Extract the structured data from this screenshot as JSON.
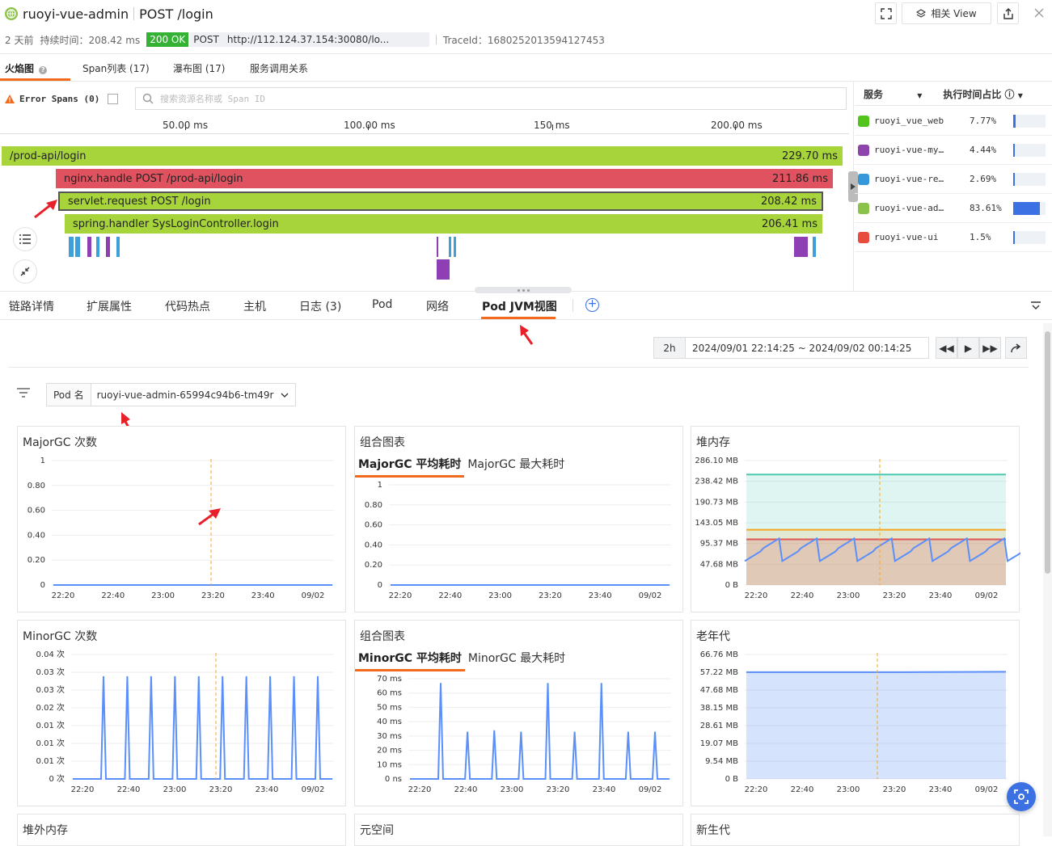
{
  "header": {
    "app": "ruoyi-vue-admin",
    "operation": "POST /login",
    "related_view": "相关 View",
    "time_ago": "2 天前",
    "duration_label": "持续时间：208.42 ms",
    "status": "200 OK",
    "method": "POST",
    "url": "http://112.124.37.154:30080/lo...",
    "trace_id": "TraceId：1680252013594127453"
  },
  "tabs": [
    {
      "label": "火焰图"
    },
    {
      "label": "Span列表 (17)"
    },
    {
      "label": "瀑布图 (17)"
    },
    {
      "label": "服务调用关系"
    }
  ],
  "flame": {
    "error_spans": "Error Spans (0)",
    "search_placeholder": "搜索资源名称或 Span ID",
    "axis": [
      "50.00 ms",
      "100.00 ms",
      "150 ms",
      "200.00 ms"
    ],
    "spans": [
      {
        "name": "/prod-api/login",
        "duration": "229.70 ms"
      },
      {
        "name": "nginx.handle POST /prod-api/login",
        "duration": "211.86 ms"
      },
      {
        "name": "servlet.request POST /login",
        "duration": "208.42 ms"
      },
      {
        "name": "spring.handler SysLoginController.login",
        "duration": "206.41 ms"
      }
    ]
  },
  "services": {
    "col_service": "服务",
    "col_ratio": "执行时间占比",
    "rows": [
      {
        "name": "ruoyi_vue_web",
        "pct": "7.77%",
        "ratio": 0.0777,
        "color": "#52c41a"
      },
      {
        "name": "ruoyi-vue-my…",
        "pct": "4.44%",
        "ratio": 0.0444,
        "color": "#8e44ad"
      },
      {
        "name": "ruoyi-vue-re…",
        "pct": "2.69%",
        "ratio": 0.0269,
        "color": "#3498db"
      },
      {
        "name": "ruoyi-vue-ad…",
        "pct": "83.61%",
        "ratio": 0.8361,
        "color": "#8bc34a"
      },
      {
        "name": "ruoyi-vue-ui",
        "pct": "1.5%",
        "ratio": 0.015,
        "color": "#e74c3c"
      }
    ]
  },
  "detail_tabs": [
    {
      "label": "链路详情"
    },
    {
      "label": "扩展属性"
    },
    {
      "label": "代码热点"
    },
    {
      "label": "主机"
    },
    {
      "label": "日志 (3)"
    },
    {
      "label": "Pod"
    },
    {
      "label": "网络"
    },
    {
      "label": "Pod JVM视图"
    }
  ],
  "timerange": {
    "preset": "2h",
    "range": "2024/09/01 22:14:25 ~ 2024/09/02 00:14:25"
  },
  "pod_filter": {
    "label": "Pod 名",
    "value": "ruoyi-vue-admin-65994c94b6-tm49r"
  },
  "chart_data": [
    {
      "type": "line",
      "title": "MajorGC 次数",
      "x": [
        "22:20",
        "22:40",
        "23:00",
        "23:20",
        "23:40",
        "09/02"
      ],
      "y_ticks": [
        "1",
        "0.80",
        "0.60",
        "0.40",
        "0.20",
        "0"
      ],
      "ylim": [
        0,
        1
      ],
      "series": [
        {
          "values": [
            0,
            0,
            0,
            0,
            0,
            0
          ]
        }
      ]
    },
    {
      "type": "line",
      "title": "组合图表",
      "tabs": [
        "MajorGC 平均耗时",
        "MajorGC 最大耗时"
      ],
      "x": [
        "22:20",
        "22:40",
        "23:00",
        "23:20",
        "23:40",
        "09/02"
      ],
      "y_ticks": [
        "1",
        "0.80",
        "0.60",
        "0.40",
        "0.20",
        "0"
      ],
      "ylim": [
        0,
        1
      ],
      "series": [
        {
          "values": [
            0,
            0,
            0,
            0,
            0,
            0
          ]
        }
      ]
    },
    {
      "type": "area",
      "title": "堆内存",
      "x": [
        "22:20",
        "22:40",
        "23:00",
        "23:20",
        "23:40",
        "09/02"
      ],
      "y_ticks": [
        "286.10 MB",
        "238.42 MB",
        "190.73 MB",
        "143.05 MB",
        "95.37 MB",
        "47.68 MB",
        "0 B"
      ],
      "ylim": [
        0,
        286.1
      ],
      "series": [
        {
          "color": "#4ec9b0",
          "values": [
            254,
            254,
            254,
            254,
            254,
            254
          ]
        },
        {
          "color": "#f5a623",
          "values": [
            127,
            127,
            127,
            127,
            127,
            127
          ]
        },
        {
          "color": "#e05555",
          "values": [
            105,
            105,
            105,
            105,
            105,
            105
          ]
        },
        {
          "color": "#5b8ff9",
          "values": [
            55,
            90,
            55,
            90,
            55,
            90
          ]
        }
      ]
    },
    {
      "type": "line",
      "title": "MinorGC 次数",
      "x": [
        "22:20",
        "22:40",
        "23:00",
        "23:20",
        "23:40",
        "09/02"
      ],
      "y_ticks": [
        "0.04 次",
        "0.03 次",
        "0.03 次",
        "0.02 次",
        "0.01 次",
        "0.01 次",
        "0.01 次",
        "0 次"
      ],
      "ylim": [
        0,
        0.04
      ],
      "series": [
        {
          "color": "#5b8ff9",
          "peaks": [
            0.033,
            0.033,
            0.033,
            0.033,
            0.033,
            0.033,
            0.033,
            0.033,
            0.033,
            0.033
          ]
        }
      ]
    },
    {
      "type": "line",
      "title": "组合图表",
      "tabs": [
        "MinorGC 平均耗时",
        "MinorGC 最大耗时"
      ],
      "x": [
        "22:20",
        "22:40",
        "23:00",
        "23:20",
        "23:40",
        "09/02"
      ],
      "y_ticks": [
        "70 ms",
        "60 ms",
        "50 ms",
        "40 ms",
        "30 ms",
        "20 ms",
        "10 ms",
        "0 ns"
      ],
      "ylim": [
        0,
        70
      ],
      "series": [
        {
          "color": "#5b8ff9",
          "peaks": [
            67,
            33,
            34,
            33,
            67,
            33,
            67,
            33,
            33
          ]
        }
      ]
    },
    {
      "type": "area",
      "title": "老年代",
      "x": [
        "22:20",
        "22:40",
        "23:00",
        "23:20",
        "23:40",
        "09/02"
      ],
      "y_ticks": [
        "66.76 MB",
        "57.22 MB",
        "47.68 MB",
        "38.15 MB",
        "28.61 MB",
        "19.07 MB",
        "9.54 MB",
        "0 B"
      ],
      "ylim": [
        0,
        66.76
      ],
      "series": [
        {
          "color": "#5b8ff9",
          "values": [
            57.3,
            57.3,
            57.3,
            57.3,
            57.4,
            57.5
          ]
        }
      ]
    }
  ],
  "bottom_cards": [
    "堆外内存",
    "元空间",
    "新生代"
  ]
}
